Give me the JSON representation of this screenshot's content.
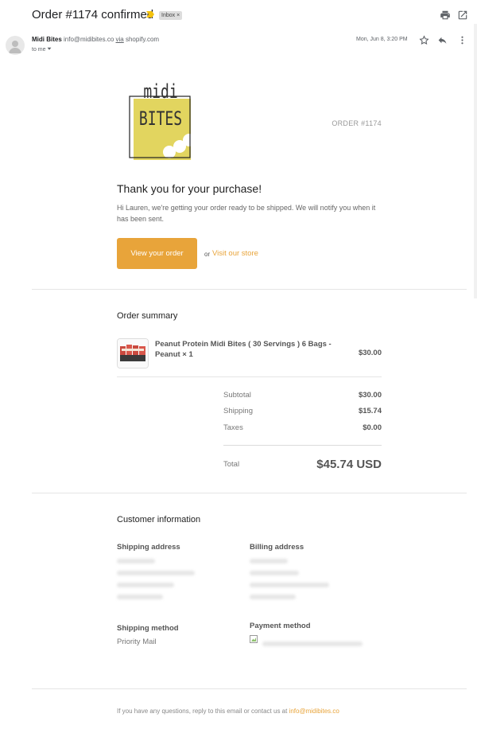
{
  "email": {
    "subject": "Order #1174 confirmed",
    "label": "Inbox",
    "label_close": "×",
    "sender_name": "Midi Bites",
    "sender_email": "info@midibites.co",
    "via": "via",
    "via_domain": "shopify.com",
    "to": "to me",
    "date": "Mon, Jun 8, 3:20 PM"
  },
  "logo": {
    "line1": "midi",
    "line2": "BITES"
  },
  "order": {
    "number_label": "ORDER #1174",
    "thanks": "Thank you for your purchase!",
    "message": "Hi Lauren, we're getting your order ready to be shipped. We will notify you when it has been sent.",
    "cta_label": "View your order",
    "or_text": "or",
    "store_link": "Visit our store"
  },
  "summary": {
    "title": "Order summary",
    "item_title": "Peanut Protein Midi Bites ( 30 Servings ) 6 Bags - Peanut × 1",
    "item_price": "$30.00",
    "subtotal_label": "Subtotal",
    "subtotal_value": "$30.00",
    "shipping_label": "Shipping",
    "shipping_value": "$15.74",
    "taxes_label": "Taxes",
    "taxes_value": "$0.00",
    "total_label": "Total",
    "total_value": "$45.74 USD"
  },
  "customer": {
    "title": "Customer information",
    "shipping_address_label": "Shipping address",
    "billing_address_label": "Billing address",
    "shipping_method_label": "Shipping method",
    "shipping_method_value": "Priority Mail",
    "payment_method_label": "Payment method"
  },
  "footer": {
    "text": "If you have any questions, reply to this email or contact us at",
    "email": "info@midibites.co"
  },
  "colors": {
    "accent": "#e8a43a",
    "logo_yellow": "#e2d55f"
  }
}
